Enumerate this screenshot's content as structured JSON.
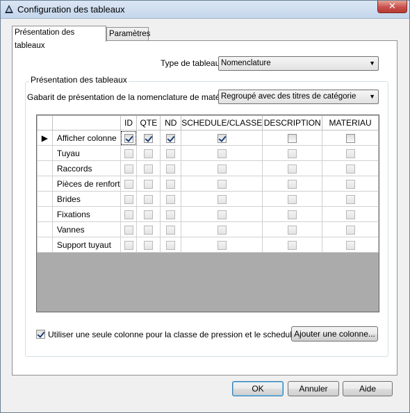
{
  "window": {
    "title": "Configuration des tableaux",
    "close_label": "✕"
  },
  "tabs": [
    {
      "label": "Présentation des tableaux",
      "active": true
    },
    {
      "label": "Paramètres",
      "active": false
    }
  ],
  "type_tableau": {
    "label": "Type de tableau:",
    "value": "Nomenclature"
  },
  "group": {
    "legend": "Présentation des tableaux"
  },
  "gabarit": {
    "label": "Gabarit de présentation de la nomenclature de matériel:",
    "value": "Regroupé avec des titres de catégorie"
  },
  "grid": {
    "columns": [
      "ID",
      "QTE",
      "ND",
      "SCHEDULE/CLASSE",
      "DESCRIPTION",
      "MATERIAU"
    ],
    "current_row_marker": "▶",
    "rows": [
      {
        "name": "Afficher colonne",
        "values": [
          true,
          true,
          true,
          true,
          false,
          false
        ],
        "enabled": true
      },
      {
        "name": "Tuyau",
        "values": [
          false,
          false,
          false,
          false,
          false,
          false
        ],
        "enabled": false
      },
      {
        "name": "Raccords",
        "values": [
          false,
          false,
          false,
          false,
          false,
          false
        ],
        "enabled": false
      },
      {
        "name": "Pièces de renfort",
        "values": [
          false,
          false,
          false,
          false,
          false,
          false
        ],
        "enabled": false
      },
      {
        "name": "Brides",
        "values": [
          false,
          false,
          false,
          false,
          false,
          false
        ],
        "enabled": false
      },
      {
        "name": "Fixations",
        "values": [
          false,
          false,
          false,
          false,
          false,
          false
        ],
        "enabled": false
      },
      {
        "name": "Vannes",
        "values": [
          false,
          false,
          false,
          false,
          false,
          false
        ],
        "enabled": false
      },
      {
        "name": "Support tuyaut",
        "values": [
          false,
          false,
          false,
          false,
          false,
          false
        ],
        "enabled": false
      }
    ]
  },
  "single_column_option": {
    "label": "Utiliser une seule colonne pour la classe de pression et le schedule",
    "checked": true
  },
  "buttons": {
    "add_column": "Ajouter une colonne...",
    "ok": "OK",
    "cancel": "Annuler",
    "help": "Aide"
  }
}
